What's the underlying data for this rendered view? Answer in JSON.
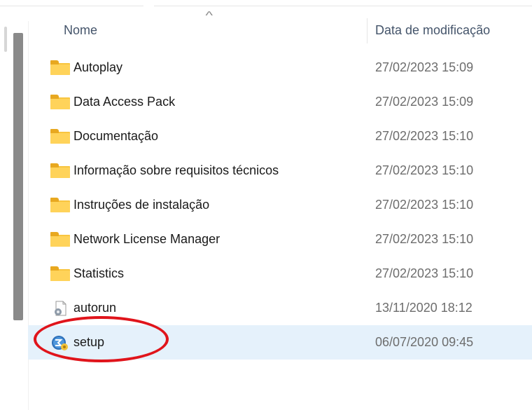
{
  "header": {
    "name_label": "Nome",
    "date_label": "Data de modificação",
    "sort_indicator": "^"
  },
  "files": [
    {
      "name": "Autoplay",
      "modified": "27/02/2023 15:09",
      "icon": "folder-icon",
      "selected": false
    },
    {
      "name": "Data Access Pack",
      "modified": "27/02/2023 15:09",
      "icon": "folder-icon",
      "selected": false
    },
    {
      "name": "Documentação",
      "modified": "27/02/2023 15:10",
      "icon": "folder-icon",
      "selected": false
    },
    {
      "name": "Informação sobre requisitos técnicos",
      "modified": "27/02/2023 15:10",
      "icon": "folder-icon",
      "selected": false
    },
    {
      "name": "Instruções de instalação",
      "modified": "27/02/2023 15:10",
      "icon": "folder-icon",
      "selected": false
    },
    {
      "name": "Network License Manager",
      "modified": "27/02/2023 15:10",
      "icon": "folder-icon",
      "selected": false
    },
    {
      "name": "Statistics",
      "modified": "27/02/2023 15:10",
      "icon": "folder-icon",
      "selected": false
    },
    {
      "name": "autorun",
      "modified": "13/11/2020 18:12",
      "icon": "settings-file-icon",
      "selected": false
    },
    {
      "name": "setup",
      "modified": "06/07/2020 09:45",
      "icon": "setup-app-icon",
      "selected": true
    }
  ],
  "colors": {
    "folder": "#f8c540",
    "selection": "#e5f1fb",
    "annotation": "#e0141b"
  }
}
